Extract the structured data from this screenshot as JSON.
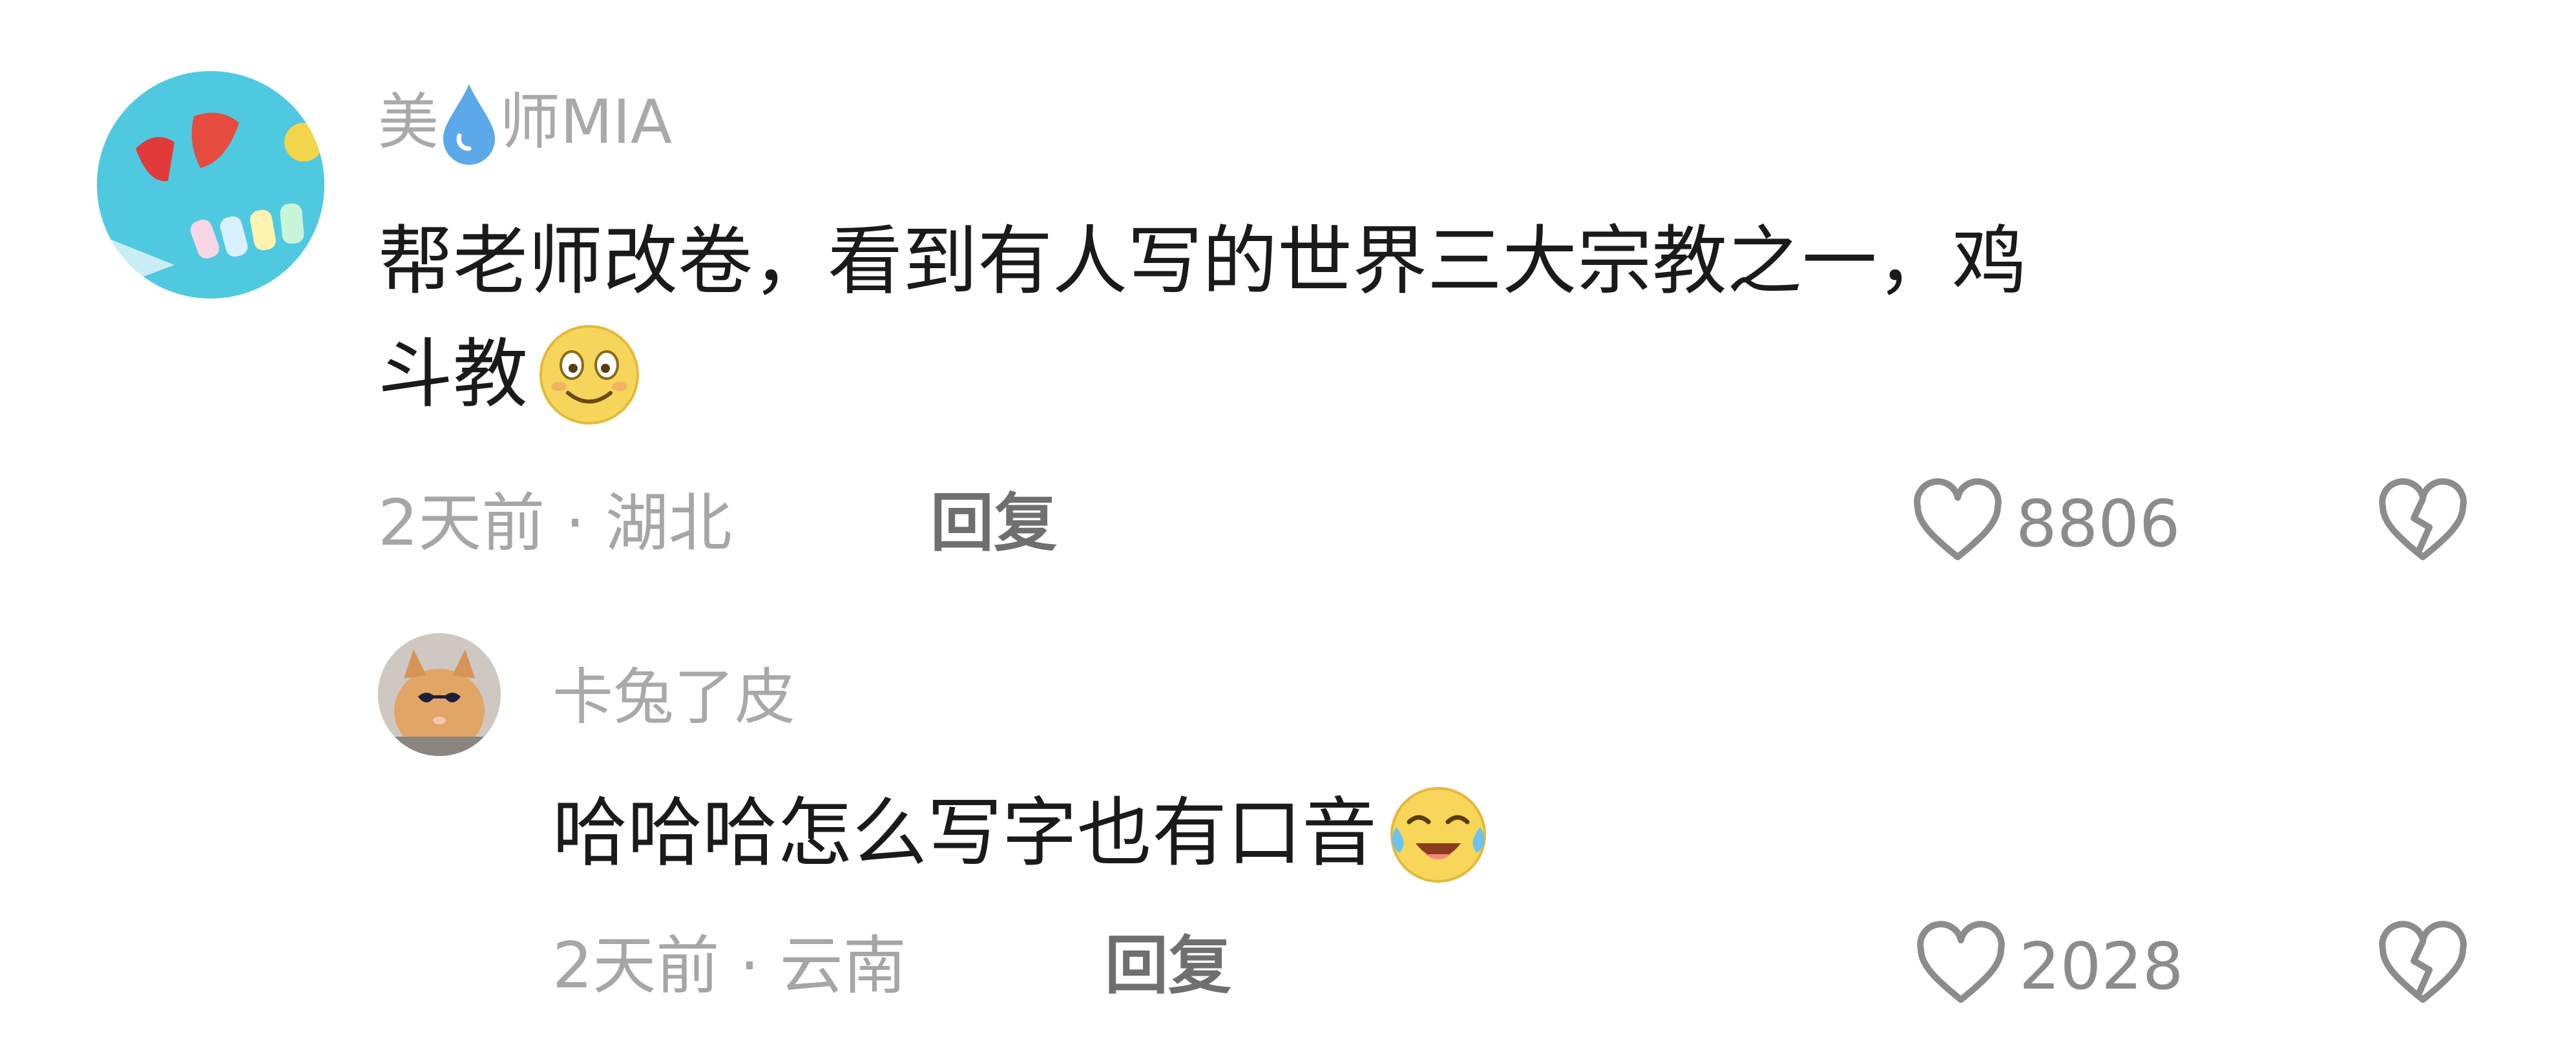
{
  "comments": [
    {
      "author": "美",
      "author_mid_icon": "water-drop-icon",
      "author_rest": "师MIA",
      "avatar_icon": "swimsuit-nails-avatar",
      "text_line1": "帮老师改卷，看到有人写的世界三大宗教之一，鸡",
      "text_line2": "斗教",
      "emoji": "smile-emoji",
      "meta": "2天前 · 湖北",
      "reply_label": "回复",
      "likes": "8806",
      "like_icon": "heart-outline-icon",
      "dislike_icon": "broken-heart-icon"
    },
    {
      "author": "卡兔了皮",
      "avatar_icon": "cat-sunglasses-avatar",
      "text": "哈哈哈怎么写字也有口音",
      "emoji": "laugh-cry-emoji",
      "meta": "2天前 · 云南",
      "reply_label": "回复",
      "likes": "2028",
      "like_icon": "heart-outline-icon",
      "dislike_icon": "broken-heart-icon"
    }
  ],
  "colors": {
    "name": "#a9a9a9",
    "text": "#1a1a1a",
    "meta": "#a6a6a6",
    "reply": "#6f6f6f",
    "icon": "#8c8c8c"
  }
}
